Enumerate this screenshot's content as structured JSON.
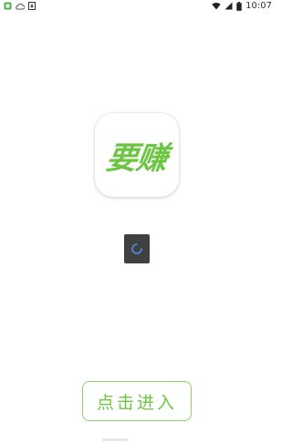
{
  "status_bar": {
    "time": "10:07",
    "left_icons": [
      "notification-icon",
      "cloud-icon",
      "download-icon"
    ],
    "right_icons": [
      "wifi-icon",
      "signal-icon",
      "battery-icon"
    ]
  },
  "app": {
    "icon_label": "要赚",
    "brand_color": "#6cc644"
  },
  "loading": {
    "spinner_color": "#4a90e2",
    "box_color": "#404040"
  },
  "enter_button": {
    "label": "点击进入",
    "border_color": "#8fd16f"
  }
}
